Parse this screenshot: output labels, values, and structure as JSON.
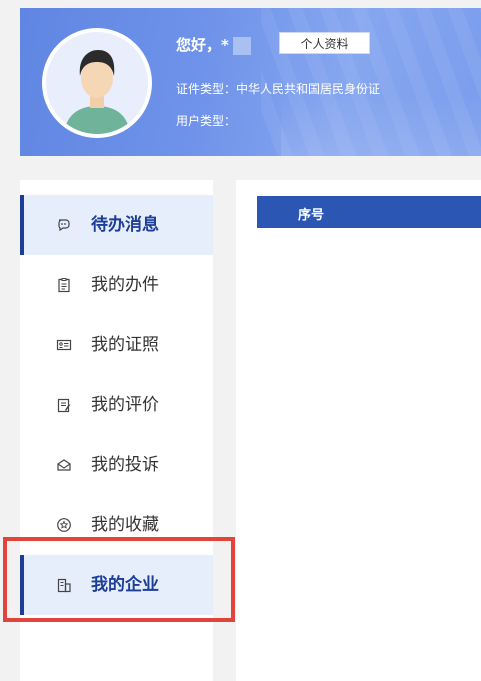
{
  "header": {
    "greeting": "您好，*",
    "profile_button": "个人资料",
    "id_type_label": "证件类型：中华人民共和国居民身份证",
    "user_type_label": "用户类型："
  },
  "sidebar": {
    "items": [
      {
        "label": "待办消息",
        "icon": "chat-bubble-icon",
        "active": true
      },
      {
        "label": "我的办件",
        "icon": "clipboard-icon",
        "active": false
      },
      {
        "label": "我的证照",
        "icon": "id-card-icon",
        "active": false
      },
      {
        "label": "我的评价",
        "icon": "edit-note-icon",
        "active": false
      },
      {
        "label": "我的投诉",
        "icon": "envelope-icon",
        "active": false
      },
      {
        "label": "我的收藏",
        "icon": "star-icon",
        "active": false
      },
      {
        "label": "我的企业",
        "icon": "building-icon",
        "active": true
      }
    ]
  },
  "table": {
    "columns": [
      "序号"
    ]
  },
  "colors": {
    "accent": "#1d3e97",
    "table_header": "#2b56b3",
    "highlight": "#e0443a",
    "active_bg": "#e6edfb"
  }
}
